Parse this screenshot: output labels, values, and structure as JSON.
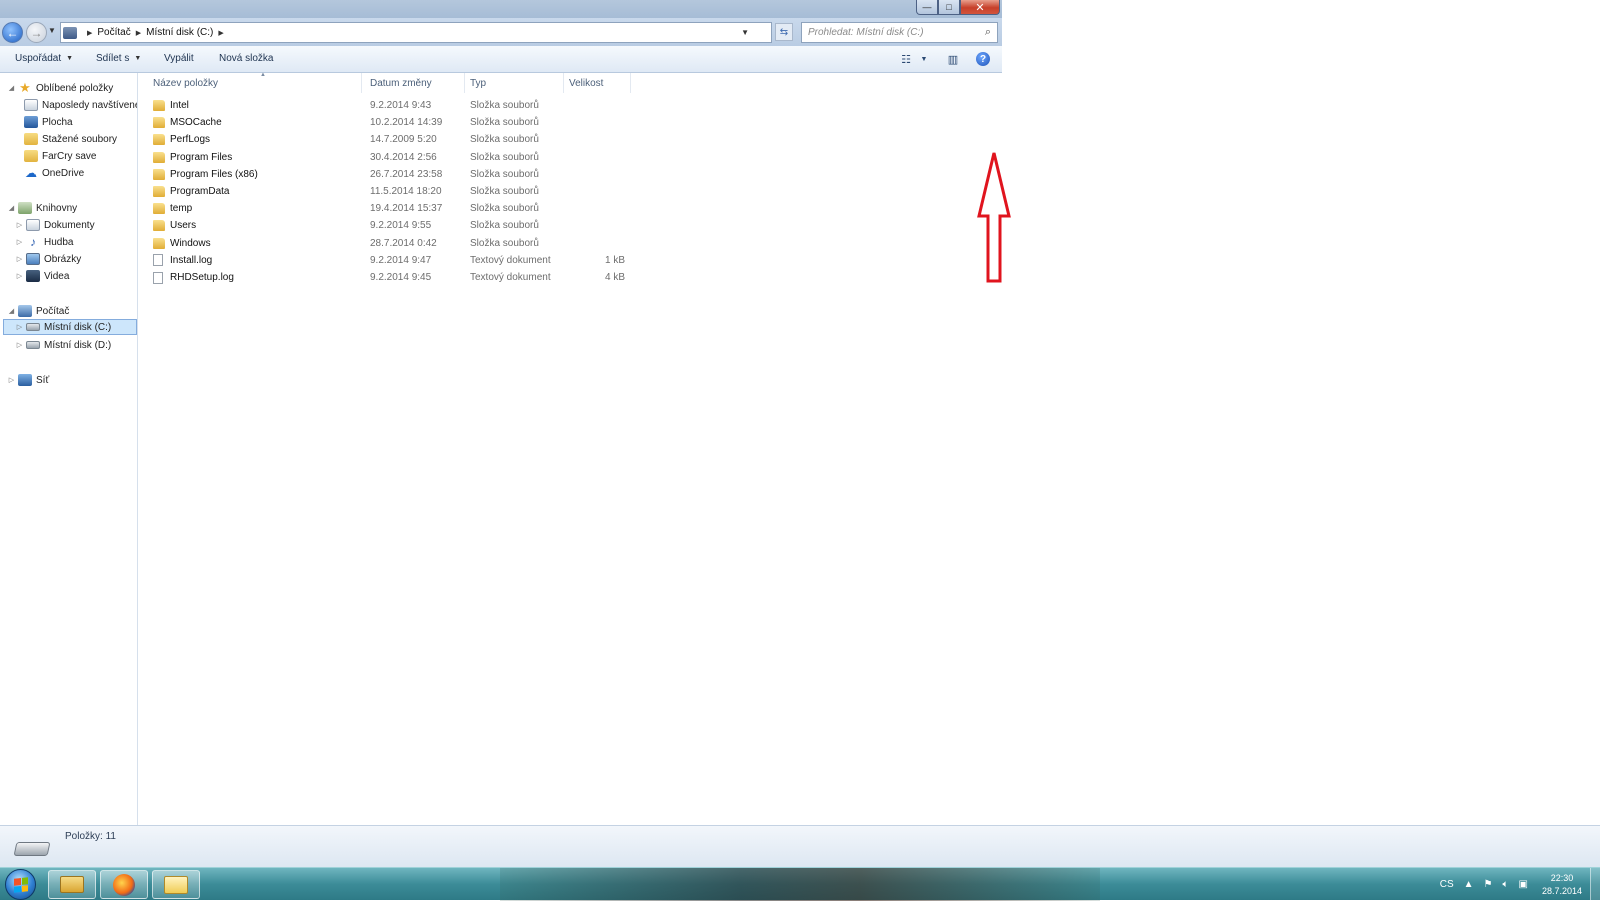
{
  "window": {
    "buttons": {
      "minimize": "—",
      "maximize": "□",
      "close": "✕"
    }
  },
  "address": {
    "crumbs": [
      "Počítač",
      "Místní disk (C:)"
    ],
    "search_placeholder": "Prohledat: Místní disk (C:)"
  },
  "toolbar": {
    "organize": "Uspořádat",
    "share": "Sdílet s",
    "burn": "Vypálit",
    "new_folder": "Nová složka"
  },
  "navpane": {
    "favorites": "Oblíbené položky",
    "fav_items": [
      "Naposledy navštívené",
      "Plocha",
      "Stažené soubory",
      "FarCry save",
      "OneDrive"
    ],
    "libraries": "Knihovny",
    "lib_items": [
      "Dokumenty",
      "Hudba",
      "Obrázky",
      "Videa"
    ],
    "computer": "Počítač",
    "drives": [
      "Místní disk (C:)",
      "Místní disk (D:)"
    ],
    "network": "Síť"
  },
  "columns": {
    "name": "Název položky",
    "date": "Datum změny",
    "type": "Typ",
    "size": "Velikost"
  },
  "files": [
    {
      "name": "Intel",
      "date": "9.2.2014 9:43",
      "type": "Složka souborů",
      "size": "",
      "kind": "folder"
    },
    {
      "name": "MSOCache",
      "date": "10.2.2014 14:39",
      "type": "Složka souborů",
      "size": "",
      "kind": "folder"
    },
    {
      "name": "PerfLogs",
      "date": "14.7.2009 5:20",
      "type": "Složka souborů",
      "size": "",
      "kind": "folder"
    },
    {
      "name": "Program Files",
      "date": "30.4.2014 2:56",
      "type": "Složka souborů",
      "size": "",
      "kind": "folder"
    },
    {
      "name": "Program Files (x86)",
      "date": "26.7.2014 23:58",
      "type": "Složka souborů",
      "size": "",
      "kind": "folder"
    },
    {
      "name": "ProgramData",
      "date": "11.5.2014 18:20",
      "type": "Složka souborů",
      "size": "",
      "kind": "folder"
    },
    {
      "name": "temp",
      "date": "19.4.2014 15:37",
      "type": "Složka souborů",
      "size": "",
      "kind": "folder"
    },
    {
      "name": "Users",
      "date": "9.2.2014 9:55",
      "type": "Složka souborů",
      "size": "",
      "kind": "folder"
    },
    {
      "name": "Windows",
      "date": "28.7.2014 0:42",
      "type": "Složka souborů",
      "size": "",
      "kind": "folder"
    },
    {
      "name": "Install.log",
      "date": "9.2.2014 9:47",
      "type": "Textový dokument",
      "size": "1 kB",
      "kind": "file"
    },
    {
      "name": "RHDSetup.log",
      "date": "9.2.2014 9:45",
      "type": "Textový dokument",
      "size": "4 kB",
      "kind": "file"
    }
  ],
  "status": {
    "items_label": "Položky: 11"
  },
  "taskbar": {
    "language": "CS",
    "time": "22:30",
    "date": "28.7.2014"
  },
  "colors": {
    "annotation_arrow": "#e0141e",
    "selection": "#cde6fb",
    "taskbar": "#3c8c98"
  }
}
